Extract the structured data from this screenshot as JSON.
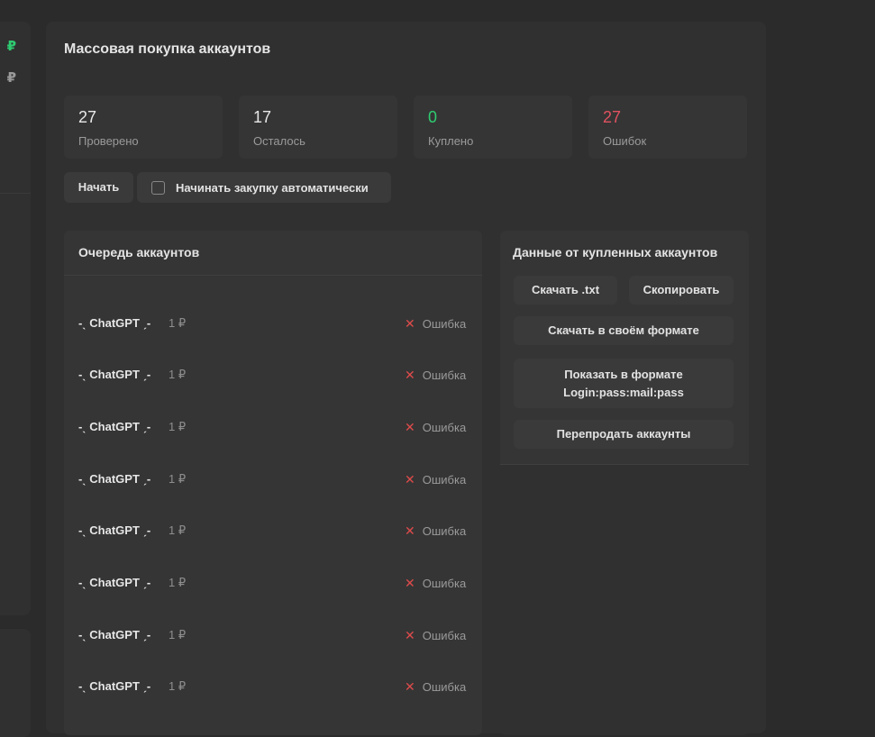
{
  "left_panel": {
    "prices": [
      {
        "text": "₽",
        "color": "#2ecc71"
      },
      {
        "text": "₽",
        "color": "#9a9a9a"
      }
    ]
  },
  "main": {
    "title": "Массовая покупка аккаунтов",
    "stats": [
      {
        "value": "27",
        "label": "Проверено",
        "color": "#e8e8e8"
      },
      {
        "value": "17",
        "label": "Осталось",
        "color": "#e8e8e8"
      },
      {
        "value": "0",
        "label": "Куплено",
        "color": "#2ecc71"
      },
      {
        "value": "27",
        "label": "Ошибок",
        "color": "#e05260"
      }
    ],
    "start_button": "Начать",
    "auto_checkbox_label": "Начинать закупку автоматически"
  },
  "queue": {
    "title": "Очередь аккаунтов",
    "peek_text": "-͟ ChatGPT ͟-",
    "rows": [
      {
        "name": "-ˎ ChatGPT ˏ-",
        "price": "1 ₽",
        "status": "Ошибка"
      },
      {
        "name": "-ˎ ChatGPT ˏ-",
        "price": "1 ₽",
        "status": "Ошибка"
      },
      {
        "name": "-ˎ ChatGPT ˏ-",
        "price": "1 ₽",
        "status": "Ошибка"
      },
      {
        "name": "-ˎ ChatGPT ˏ-",
        "price": "1 ₽",
        "status": "Ошибка"
      },
      {
        "name": "-ˎ ChatGPT ˏ-",
        "price": "1 ₽",
        "status": "Ошибка"
      },
      {
        "name": "-ˎ ChatGPT ˏ-",
        "price": "1 ₽",
        "status": "Ошибка"
      },
      {
        "name": "-ˎ ChatGPT ˏ-",
        "price": "1 ₽",
        "status": "Ошибка"
      },
      {
        "name": "-ˎ ChatGPT ˏ-",
        "price": "1 ₽",
        "status": "Ошибка"
      }
    ]
  },
  "purchased": {
    "title": "Данные от купленных аккаунтов",
    "download_txt": "Скачать .txt",
    "copy": "Скопировать",
    "download_custom": "Скачать в своём формате",
    "show_format": "Показать в формате Login:pass:mail:pass",
    "resell": "Перепродать аккаунты"
  }
}
